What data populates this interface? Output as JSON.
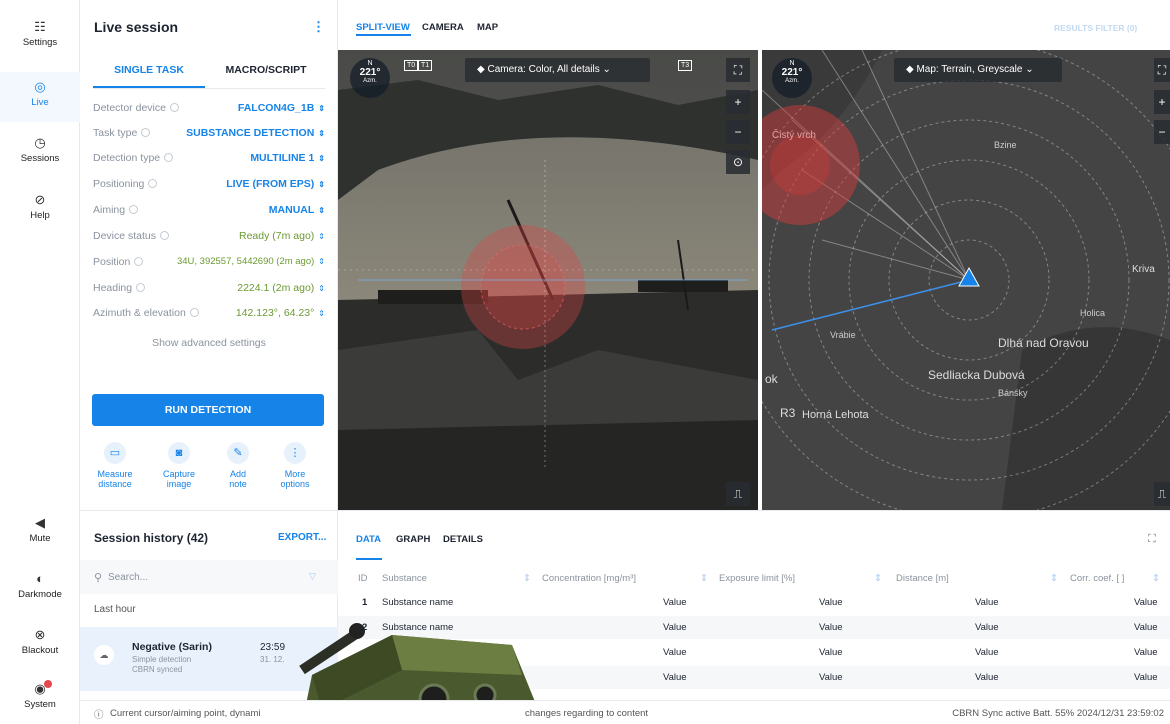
{
  "rail": [
    {
      "name": "settings",
      "icon": "☷",
      "label": "Settings"
    },
    {
      "name": "live",
      "icon": "◎",
      "label": "Live"
    },
    {
      "name": "sessions",
      "icon": "◷",
      "label": "Sessions"
    },
    {
      "name": "help",
      "icon": "⊘",
      "label": "Help"
    },
    {
      "name": "mute",
      "icon": "◀",
      "label": "Mute"
    },
    {
      "name": "darkmode",
      "icon": "◐",
      "label": "Darkmode"
    },
    {
      "name": "blackout",
      "icon": "⊗",
      "label": "Blackout"
    },
    {
      "name": "system",
      "icon": "◉",
      "label": "System"
    }
  ],
  "panel": {
    "title": "Live session",
    "menu_icon": "⋮",
    "tabs": [
      "SINGLE TASK",
      "MACRO/SCRIPT"
    ],
    "settings": [
      {
        "label": "Detector device",
        "value": "FALCON4G_1B"
      },
      {
        "label": "Task type",
        "value": "SUBSTANCE DETECTION"
      },
      {
        "label": "Detection type",
        "value": "MULTILINE 1"
      },
      {
        "label": "Positioning",
        "value": "LIVE (FROM EPS)"
      },
      {
        "label": "Aiming",
        "value": "MANUAL"
      },
      {
        "label": "Device status",
        "value": "Ready (7m ago)"
      },
      {
        "label": "Position",
        "value": "34U, 392557, 5442690 (2m ago)"
      },
      {
        "label": "Heading",
        "value": "2224.1 (2m ago)"
      },
      {
        "label": "Azimuth & elevation",
        "value": "142.123°, 64.23°"
      }
    ],
    "advanced": "Show advanced settings",
    "run": "RUN DETECTION",
    "tools": [
      {
        "icon": "▭",
        "l1": "Measure",
        "l2": "distance"
      },
      {
        "icon": "◙",
        "l1": "Capture",
        "l2": "image"
      },
      {
        "icon": "✎",
        "l1": "Add",
        "l2": "note"
      },
      {
        "icon": "⋮",
        "l1": "More",
        "l2": "options"
      }
    ],
    "history": {
      "title": "Session history (42)",
      "export": "EXPORT...",
      "search": "Search...",
      "group": "Last hour",
      "item": {
        "title": "Negative (Sarin)",
        "sub1": "Simple detection",
        "sub2": "CBRN synced",
        "time": "23:59",
        "date": "31. 12."
      }
    }
  },
  "topbar": {
    "tabs": [
      "SPLIT-VIEW",
      "CAMERA",
      "MAP"
    ],
    "filter": "RESULTS FILTER (0)"
  },
  "camera": {
    "dropdown": "Camera:  Color, All details",
    "azimuth": "221°",
    "north": "N",
    "azm": "Azm.",
    "tags": [
      "T0",
      "T1",
      "T3"
    ]
  },
  "map": {
    "dropdown": "Map:  Terrain, Greyscale",
    "azimuth": "221°",
    "north": "N",
    "azm": "Azm.",
    "labels": [
      "Čistý vrch",
      "Bzine",
      "Kriva",
      "Holica",
      "Dlhá nad Oravou",
      "Vrábie",
      "Sedliacka Dubová",
      "Bánsky",
      "Horná Lehota",
      "R3",
      "ok"
    ]
  },
  "data": {
    "tabs": [
      "DATA",
      "GRAPH",
      "DETAILS"
    ],
    "columns": [
      "ID",
      "Substance",
      "Concentration [mg/m³]",
      "Exposure limit [%]",
      "Distance [m]",
      "Corr. coef. [ ]"
    ],
    "rows": [
      {
        "id": "1",
        "substance": "Substance name",
        "v": [
          "Value",
          "Value",
          "Value",
          "Value"
        ]
      },
      {
        "id": "2",
        "substance": "Substance name",
        "v": [
          "Value",
          "Value",
          "Value",
          "Value"
        ]
      },
      {
        "id": "",
        "substance": "",
        "v": [
          "Value",
          "Value",
          "Value",
          "Value"
        ]
      },
      {
        "id": "",
        "substance": "",
        "v": [
          "Value",
          "Value",
          "Value",
          "Value"
        ]
      }
    ]
  },
  "status": {
    "left": "Current cursor/aiming point, dynami",
    "mid": "changes regarding to content",
    "right": "CBRN Sync active  Batt. 55%  2024/12/31  23:59:02"
  }
}
